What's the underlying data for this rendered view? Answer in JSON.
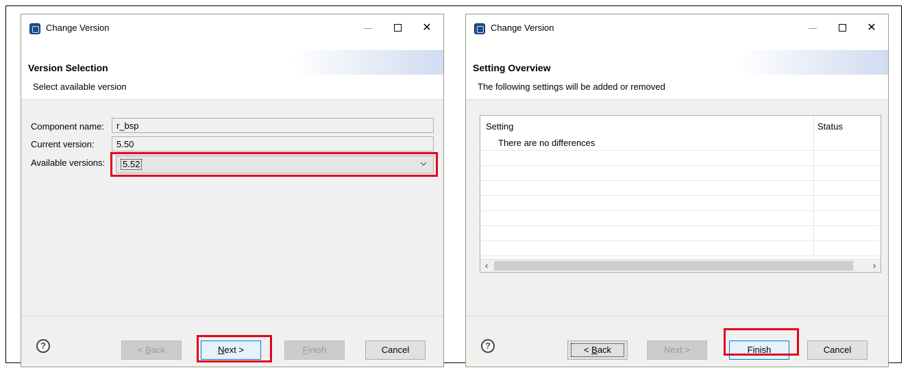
{
  "left_dialog": {
    "title": "Change Version",
    "banner_title": "Version Selection",
    "banner_subtitle": "Select available version",
    "fields": {
      "component_label": "Component name:",
      "component_value": "r_bsp",
      "current_label": "Current version:",
      "current_value": "5.50",
      "available_label": "Available versions:",
      "available_value": "5.52"
    },
    "buttons": {
      "back_prefix": "< ",
      "back_mnemonic": "B",
      "back_rest": "ack",
      "next_mnemonic": "N",
      "next_rest": "ext >",
      "finish_mnemonic": "F",
      "finish_rest": "inish",
      "cancel": "Cancel"
    },
    "help_glyph": "?"
  },
  "right_dialog": {
    "title": "Change Version",
    "banner_title": "Setting Overview",
    "banner_subtitle": "The following settings will be added or removed",
    "table": {
      "columns": [
        "Setting",
        "Status"
      ],
      "rows": [
        "There are no differences"
      ]
    },
    "buttons": {
      "back_prefix": "< ",
      "back_mnemonic": "B",
      "back_rest": "ack",
      "next": "Next >",
      "finish_mnemonic": "F",
      "finish_rest": "inish",
      "cancel": "Cancel"
    },
    "help_glyph": "?"
  },
  "colors": {
    "highlight": "#e2001a",
    "dialog_border": "#8fa37a",
    "default_button_border": "#0078d7"
  }
}
